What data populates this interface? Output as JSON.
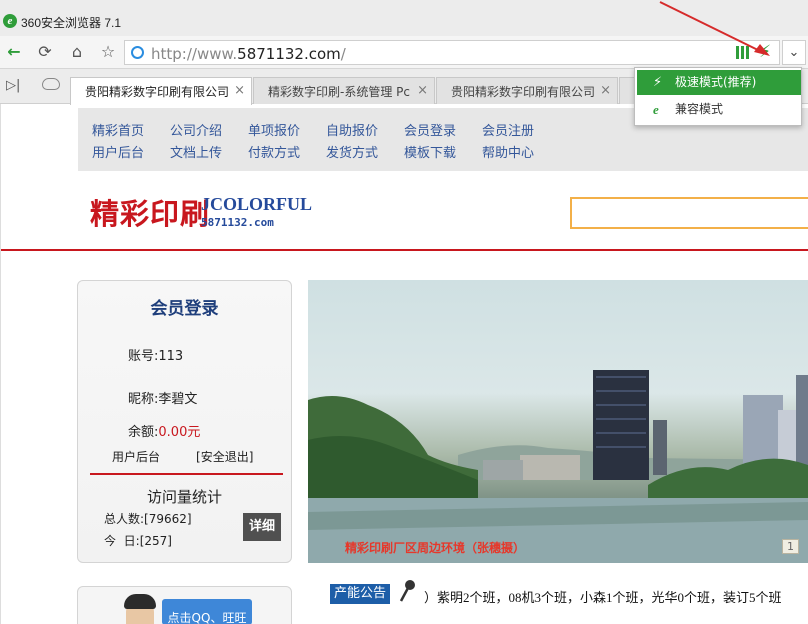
{
  "browser": {
    "title": "360安全浏览器 7.1",
    "url_prefix": "http://www.",
    "url_domain": "5871132.com",
    "url_suffix": "/",
    "tabs": [
      {
        "label": "贵阳精彩数字印刷有限公司",
        "active": true
      },
      {
        "label": "精彩数字印刷-系统管理 Pc",
        "active": false
      },
      {
        "label": "贵阳精彩数字印刷有限公司",
        "active": false
      }
    ],
    "mode_menu": {
      "fast": "极速模式(推荐)",
      "compat": "兼容模式"
    },
    "colors": {
      "accent": "#2f9d3a",
      "annotation_arrow": "#d62b2b"
    }
  },
  "site": {
    "menu_row1": [
      "精彩首页",
      "公司介绍",
      "单项报价",
      "自助报价",
      "会员登录",
      "会员注册"
    ],
    "menu_row2": [
      "用户后台",
      "文档上传",
      "付款方式",
      "发货方式",
      "模板下载",
      "帮助中心"
    ],
    "brand_cn": "精彩印刷",
    "brand_en": "JCOLORFUL",
    "brand_url": "5871132.com",
    "login": {
      "heading": "会员登录",
      "account_label": "账号:",
      "account_value": "113",
      "nickname_label": "昵称:",
      "nickname_value": "李碧文",
      "balance_label": "余额:",
      "balance_value": "0.00元",
      "user_backend": "用户后台",
      "logout": "[安全退出]",
      "stats_heading": "访问量统计",
      "total_label": "总人数:",
      "total_value": "[79662]",
      "today_label": "今  日:",
      "today_value": "[257]",
      "detail_button": "详细"
    },
    "banner_caption": "精彩印刷厂区周边环境（张穗摄）",
    "banner_page": "1",
    "announcement_label": "产能公告",
    "announcement_text": "）紫明2个班，08机3个班，小森1个班，光华0个班，装订5个班",
    "service_text": "点击QQ、旺旺"
  }
}
